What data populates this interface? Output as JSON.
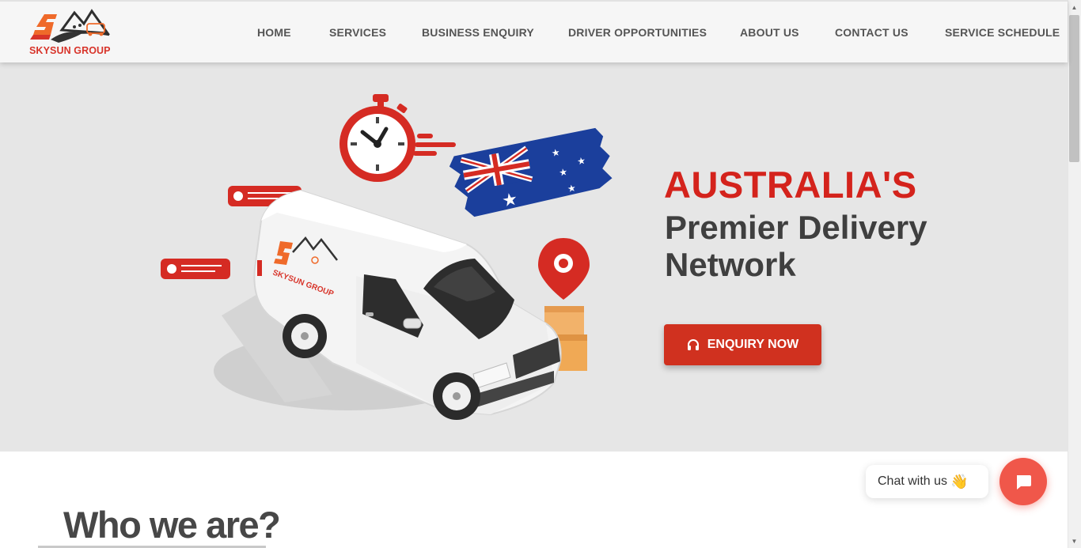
{
  "brand": {
    "name": "SKYSUN GROUP",
    "accent": "#d4231c"
  },
  "nav": [
    {
      "label": "HOME"
    },
    {
      "label": "SERVICES"
    },
    {
      "label": "BUSINESS ENQUIRY"
    },
    {
      "label": "DRIVER OPPORTUNITIES"
    },
    {
      "label": "ABOUT US"
    },
    {
      "label": "CONTACT US"
    },
    {
      "label": "SERVICE SCHEDULE"
    }
  ],
  "hero": {
    "headline": "AUSTRALIA'S",
    "subheadline": "Premier Delivery Network",
    "cta_label": "ENQUIRY NOW",
    "cta_icon": "headphones-icon",
    "van_logo_text": "SKYSUN GROUP"
  },
  "section": {
    "title": "Who we are?"
  },
  "chat": {
    "label": "Chat with us",
    "emoji": "👋",
    "icon": "chat-icon"
  }
}
